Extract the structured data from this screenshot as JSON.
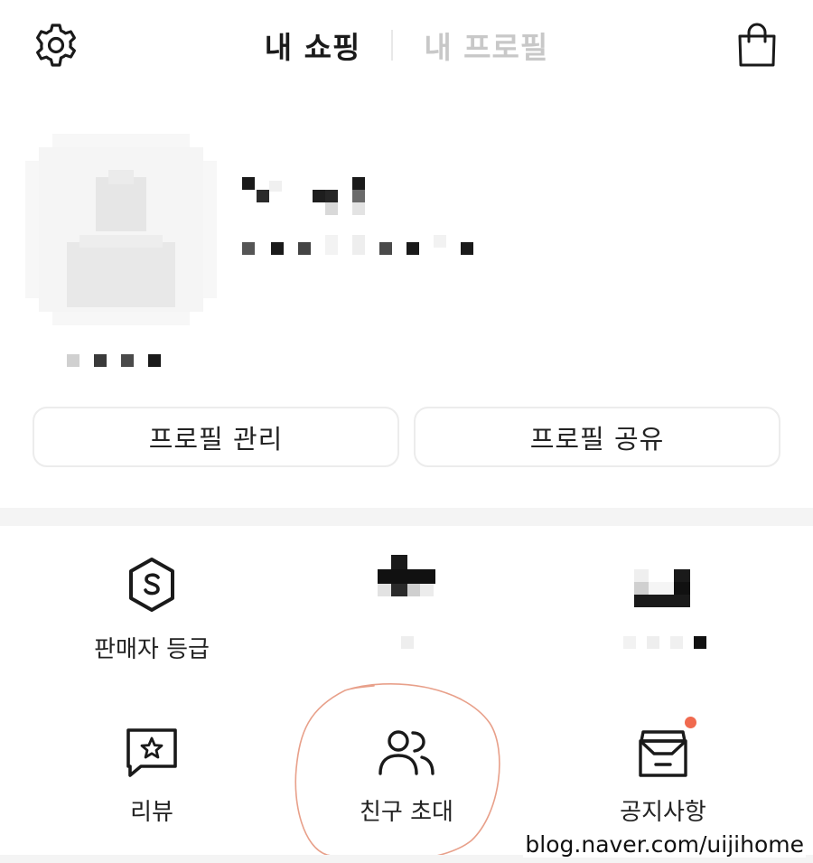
{
  "header": {
    "settings_icon": "gear-icon",
    "tabs": [
      {
        "label": "내 쇼핑",
        "active": true
      },
      {
        "label": "내 프로필",
        "active": false
      }
    ],
    "bag_icon": "shopping-bag-icon"
  },
  "profile": {
    "avatar": "blurred-avatar",
    "buttons": {
      "manage_label": "프로필 관리",
      "share_label": "프로필 공유"
    }
  },
  "menu": {
    "row1": [
      {
        "label": "판매자 등급",
        "icon": "seller-grade-icon"
      },
      {
        "label": "",
        "icon": "pixelated-icon"
      },
      {
        "label": "",
        "icon": "pixelated-icon"
      }
    ],
    "row2": [
      {
        "label": "리뷰",
        "icon": "review-star-icon"
      },
      {
        "label": "친구 초대",
        "icon": "friends-icon"
      },
      {
        "label": "공지사항",
        "icon": "notice-inbox-icon",
        "badge": true
      }
    ]
  },
  "watermark": "blog.naver.com/uijihome",
  "colors": {
    "accent_badge": "#f06a4f",
    "inactive_tab": "#c8c8c8",
    "highlight_stroke": "#e8a08a"
  }
}
